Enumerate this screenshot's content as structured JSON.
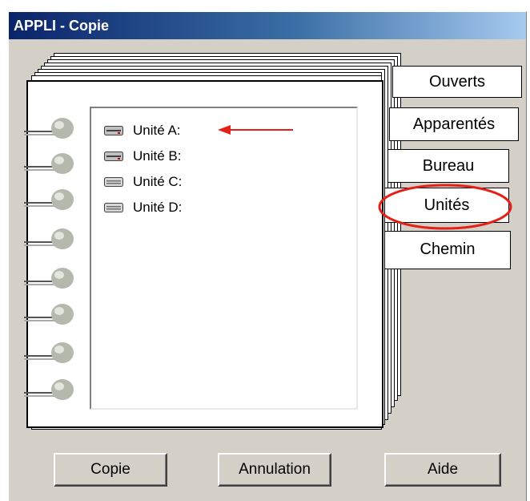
{
  "window": {
    "title": "APPLI - Copie"
  },
  "drives": [
    {
      "label": "Unité A:",
      "icon": "floppy-drive-icon"
    },
    {
      "label": "Unité B:",
      "icon": "floppy-drive-icon"
    },
    {
      "label": "Unité C:",
      "icon": "hard-drive-icon"
    },
    {
      "label": "Unité D:",
      "icon": "hard-drive-icon"
    }
  ],
  "tabs": [
    {
      "label": "Ouverts"
    },
    {
      "label": "Apparentés"
    },
    {
      "label": "Bureau"
    },
    {
      "label": "Unités",
      "highlighted": true
    },
    {
      "label": "Chemin"
    }
  ],
  "buttons": {
    "copy": "Copie",
    "cancel": "Annulation",
    "help": "Aide"
  },
  "annotations": {
    "arrow_color": "#e32119",
    "highlight_color": "#e32119"
  }
}
